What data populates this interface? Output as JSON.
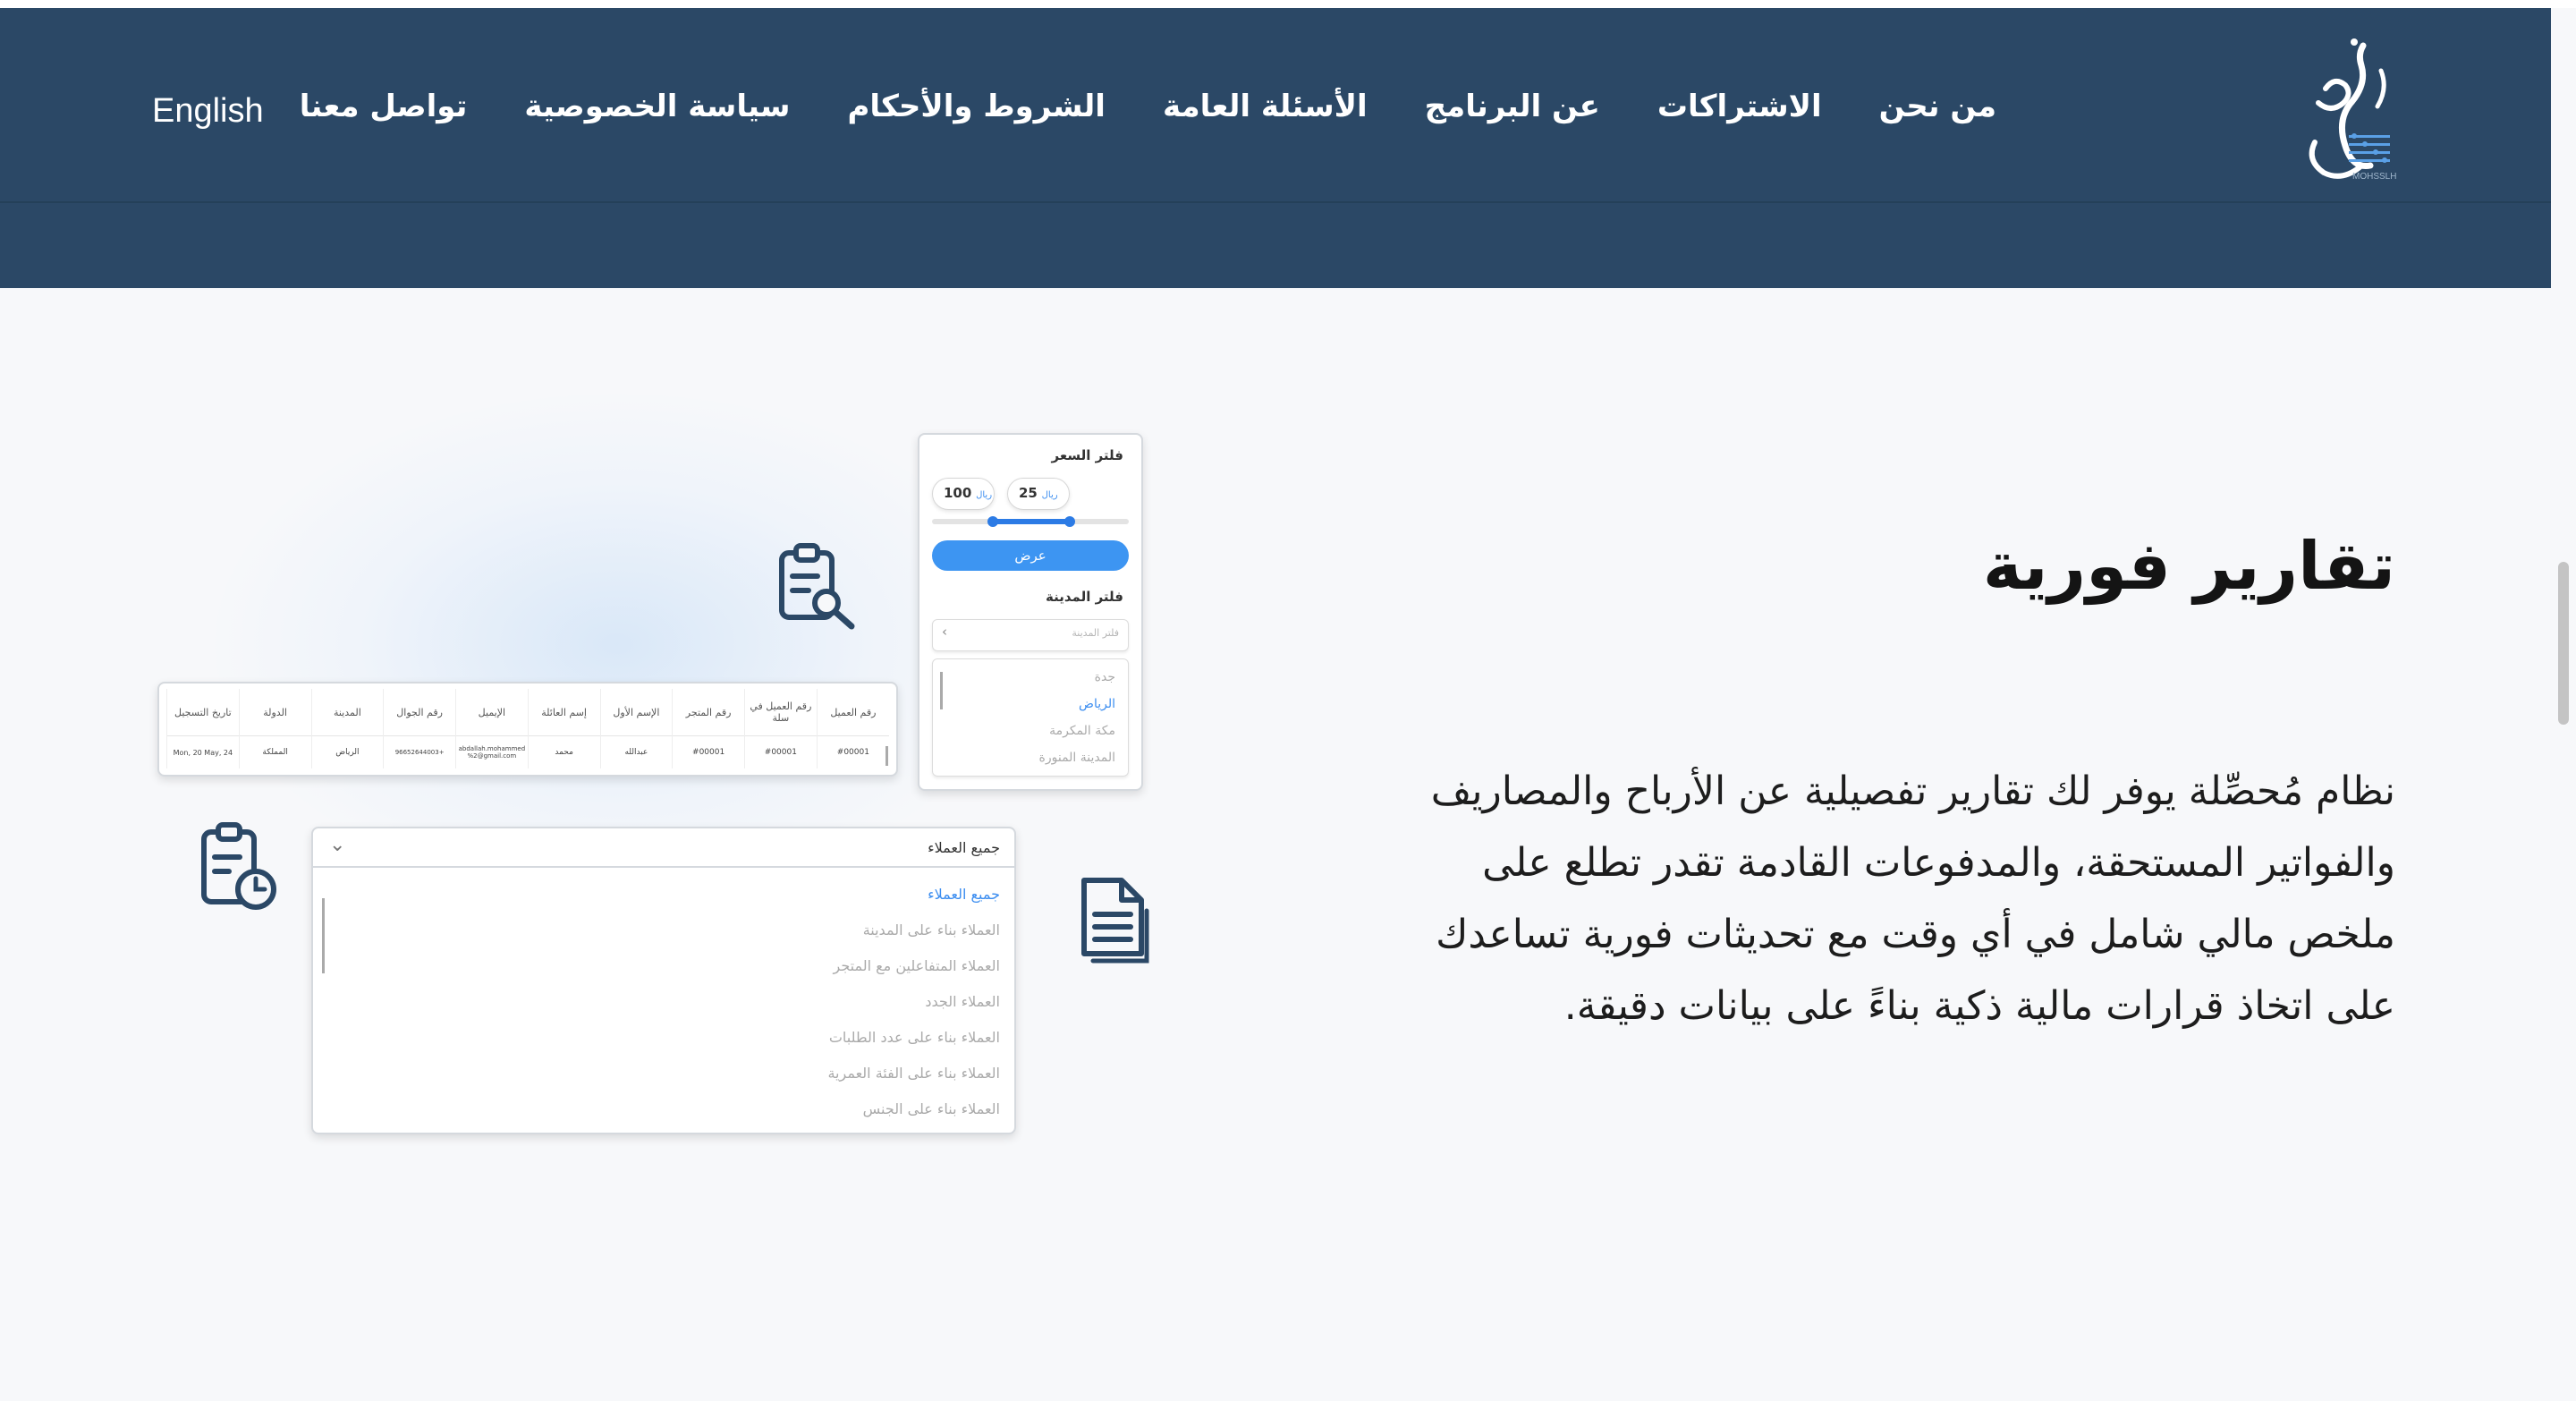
{
  "header": {
    "language_label": "English",
    "nav": [
      "من نحن",
      "الاشتراكات",
      "عن البرنامج",
      "الأسئلة العامة",
      "الشروط والأحكام",
      "سياسة الخصوصية",
      "تواصل معنا"
    ],
    "logo_sub": "MOHSSLH"
  },
  "hero": {
    "title": "تقارير فورية",
    "description_lines": [
      "نظام مُحصِّلة يوفر لك تقارير تفصيلية عن الأرباح والمصاريف",
      "والفواتير المستحقة، والمدفوعات القادمة تقدر تطلع على",
      "ملخص مالي شامل في أي وقت مع تحديثات فورية تساعدك",
      "على اتخاذ قرارات مالية ذكية بناءً على بيانات دقيقة."
    ]
  },
  "price_filter": {
    "title": "فلتر السعر",
    "min_value": "25",
    "max_value": "100",
    "currency": "ريال",
    "show_button": "عرض",
    "city_title": "فلتر المدينة",
    "city_placeholder": "فلتر المدينة",
    "cities": [
      "جدة",
      "الرياض",
      "مكة المكرمة",
      "المدينة المنورة"
    ],
    "selected_city": "الرياض"
  },
  "customers_table": {
    "headers": [
      "رقم العميل",
      "رقم العميل في سلة",
      "رقم المتجر",
      "الإسم الأول",
      "إسم العائلة",
      "الإيميل",
      "رقم الجوال",
      "المدينة",
      "الدولة",
      "تاريخ التسجيل"
    ],
    "rows": [
      [
        "#00001",
        "#00001",
        "#00001",
        "عبدالله",
        "محمد",
        "abdallah.mohammed %2@gmail.com",
        "+96652644003",
        "الرياض",
        "المملكة",
        "Mon, 20 May, 24"
      ]
    ]
  },
  "customers_filter": {
    "selected": "جميع العملاء",
    "options": [
      "جميع العملاء",
      "العملاء بناء على المدينة",
      "العملاء المتفاعلين مع المتجر",
      "العملاء الجدد",
      "العملاء بناء على عدد الطلبات",
      "العملاء بناء على الفئة العمرية",
      "العملاء بناء على الجنس"
    ]
  },
  "icons": [
    "clipboard-search-icon",
    "clipboard-clock-icon",
    "document-icon",
    "chevron-down-icon"
  ],
  "colors": {
    "header_bg": "#2b4866",
    "accent_blue": "#3d95f2",
    "icon_navy": "#2b4866",
    "page_bg": "#f7f8fa"
  }
}
